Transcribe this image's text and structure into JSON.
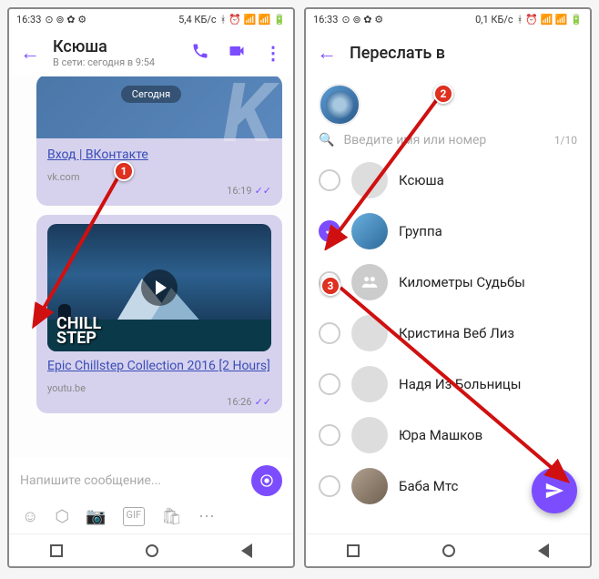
{
  "status": {
    "time": "16:33",
    "data_rate1": "5,4 КБ/с",
    "data_rate2": "0,1 КБ/с"
  },
  "phone1": {
    "header": {
      "title": "Ксюша",
      "subtitle": "В сети: сегодня в 9:54"
    },
    "day_chip": "Сегодня",
    "msg1": {
      "link": "Вход | ВКонтакте",
      "domain": "vk.com",
      "time": "16:19"
    },
    "msg2": {
      "chill1": "CHILL",
      "chill2": "STEP",
      "link": "Epic Chillstep Collection 2016 [2 Hours]",
      "domain": "youtu.be",
      "time": "16:26"
    },
    "input_placeholder": "Напишите сообщение..."
  },
  "phone2": {
    "header_title": "Переслать в",
    "search_placeholder": "Введите имя или номер",
    "search_counter": "1/10",
    "contacts": [
      {
        "name": "Ксюша",
        "checked": false,
        "avatar": "plain"
      },
      {
        "name": "Группа",
        "checked": true,
        "avatar": "blue-car"
      },
      {
        "name": "Километры Судьбы",
        "checked": false,
        "avatar": "grey-group"
      },
      {
        "name": "Кристина Веб Лиз",
        "checked": false,
        "avatar": "plain"
      },
      {
        "name": "Надя Из Больницы",
        "checked": false,
        "avatar": "plain"
      },
      {
        "name": "Юра Машков",
        "checked": false,
        "avatar": "plain"
      },
      {
        "name": "Баба Мтс",
        "checked": false,
        "avatar": "photo"
      }
    ]
  },
  "markers": {
    "m1": "1",
    "m2": "2",
    "m3": "3"
  }
}
